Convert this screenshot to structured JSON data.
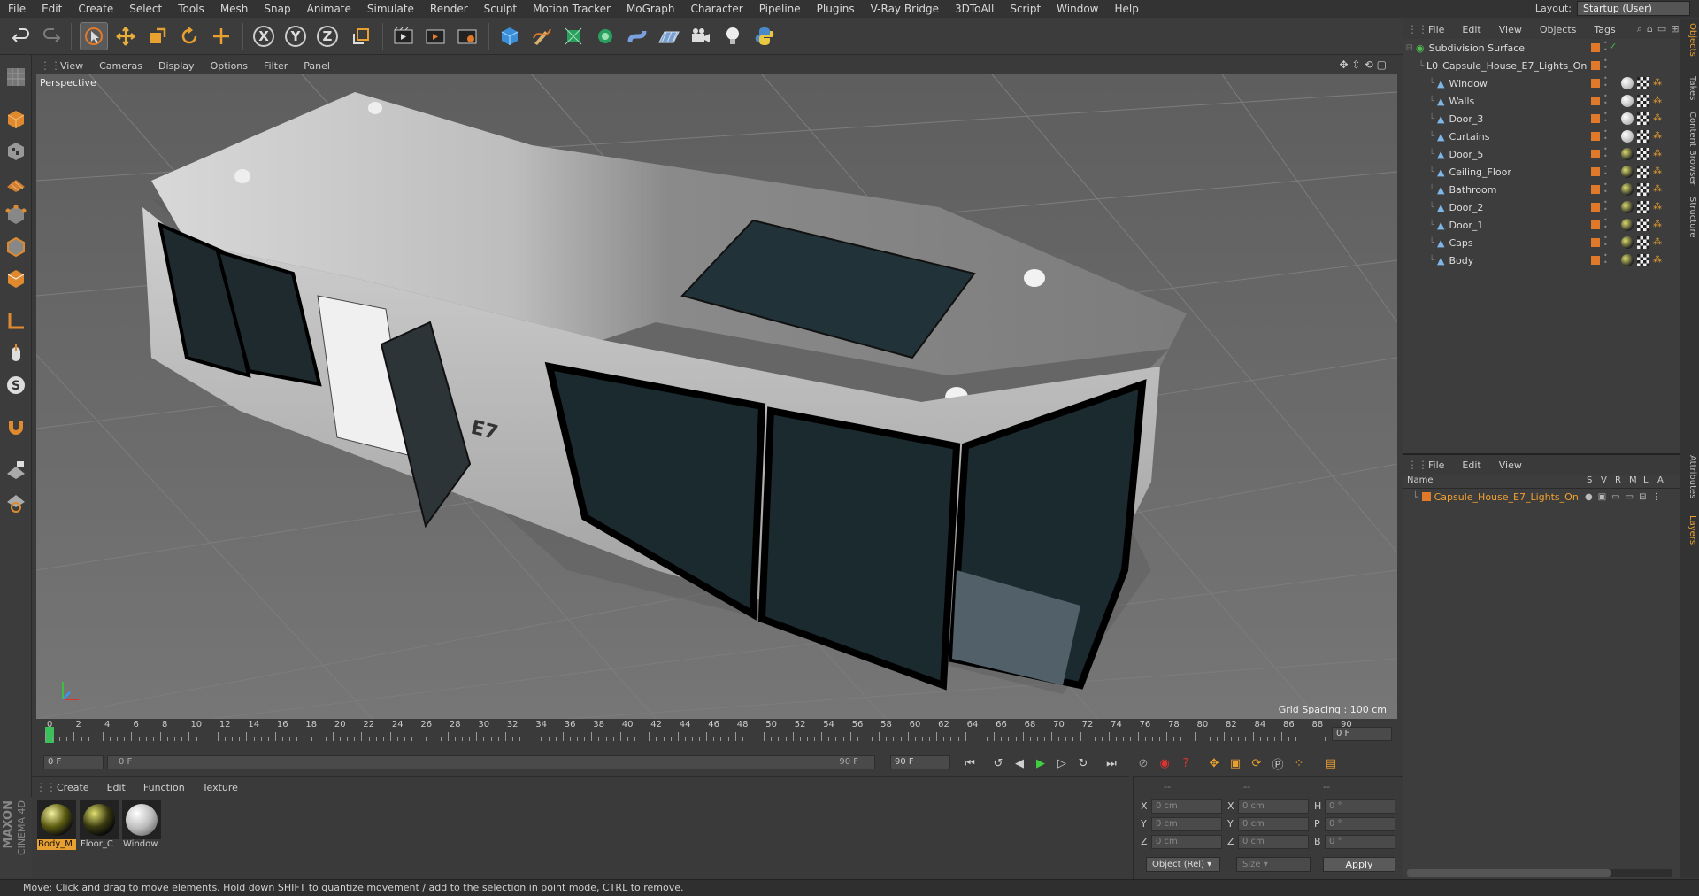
{
  "menubar": {
    "items": [
      "File",
      "Edit",
      "Create",
      "Select",
      "Tools",
      "Mesh",
      "Snap",
      "Animate",
      "Simulate",
      "Render",
      "Sculpt",
      "Motion Tracker",
      "MoGraph",
      "Character",
      "Pipeline",
      "Plugins",
      "V-Ray Bridge",
      "3DToAll",
      "Script",
      "Window",
      "Help"
    ],
    "layout_label": "Layout:",
    "layout_value": "Startup (User)"
  },
  "toolbar": {
    "x": "X",
    "y": "Y",
    "z": "Z"
  },
  "viewport": {
    "menu": [
      "View",
      "Cameras",
      "Display",
      "Options",
      "Filter",
      "Panel"
    ],
    "label": "Perspective",
    "grid_spacing": "Grid Spacing : 100 cm",
    "logo_text": "E7"
  },
  "timeline": {
    "ticks": [
      "0",
      "2",
      "4",
      "6",
      "8",
      "10",
      "12",
      "14",
      "16",
      "18",
      "20",
      "22",
      "24",
      "26",
      "28",
      "30",
      "32",
      "34",
      "36",
      "38",
      "40",
      "42",
      "44",
      "46",
      "48",
      "50",
      "52",
      "54",
      "56",
      "58",
      "60",
      "62",
      "64",
      "66",
      "68",
      "70",
      "72",
      "74",
      "76",
      "78",
      "80",
      "82",
      "84",
      "86",
      "88",
      "90"
    ],
    "frame_field": "0 F"
  },
  "transport": {
    "start": "0 F",
    "range_start": "0 F",
    "range_end": "90 F",
    "end": "90 F"
  },
  "materials": {
    "menu": [
      "Create",
      "Edit",
      "Function",
      "Texture"
    ],
    "items": [
      {
        "label": "Body_M"
      },
      {
        "label": "Floor_C"
      },
      {
        "label": "Window"
      }
    ]
  },
  "coords": {
    "header": [
      "--",
      "--",
      "--"
    ],
    "rows": [
      {
        "a": "X",
        "av": "0 cm",
        "b": "X",
        "bv": "0 cm",
        "c": "H",
        "cv": "0 °"
      },
      {
        "a": "Y",
        "av": "0 cm",
        "b": "Y",
        "bv": "0 cm",
        "c": "P",
        "cv": "0 °"
      },
      {
        "a": "Z",
        "av": "0 cm",
        "b": "Z",
        "bv": "0 cm",
        "c": "B",
        "cv": "0 °"
      }
    ],
    "mode": "Object (Rel)",
    "size": "Size",
    "apply": "Apply"
  },
  "objects": {
    "menu": [
      "File",
      "Edit",
      "View",
      "Objects",
      "Tags"
    ],
    "root": "Subdivision Surface",
    "group": "Capsule_House_E7_Lights_On",
    "children": [
      "Window",
      "Walls",
      "Door_3",
      "Curtains",
      "Door_5",
      "Ceiling_Floor",
      "Bathroom",
      "Door_2",
      "Door_1",
      "Caps",
      "Body"
    ]
  },
  "layers": {
    "menu": [
      "File",
      "Edit",
      "View"
    ],
    "header": {
      "name": "Name",
      "cols": [
        "S",
        "V",
        "R",
        "M",
        "L",
        "A"
      ]
    },
    "items": [
      "Capsule_House_E7_Lights_On"
    ]
  },
  "right_tabs": [
    "Objects",
    "Takes",
    "Content Browser",
    "Structure",
    "Attributes",
    "Layers"
  ],
  "brand": {
    "maxon": "MAXON",
    "cinema": "CINEMA 4D"
  },
  "status": "Move: Click and drag to move elements. Hold down SHIFT to quantize movement / add to the selection in point mode, CTRL to remove.",
  "colors": {
    "accent_orange": "#e07a2a",
    "selected_text": "#f0a030",
    "green_check": "#3fbf3f"
  }
}
